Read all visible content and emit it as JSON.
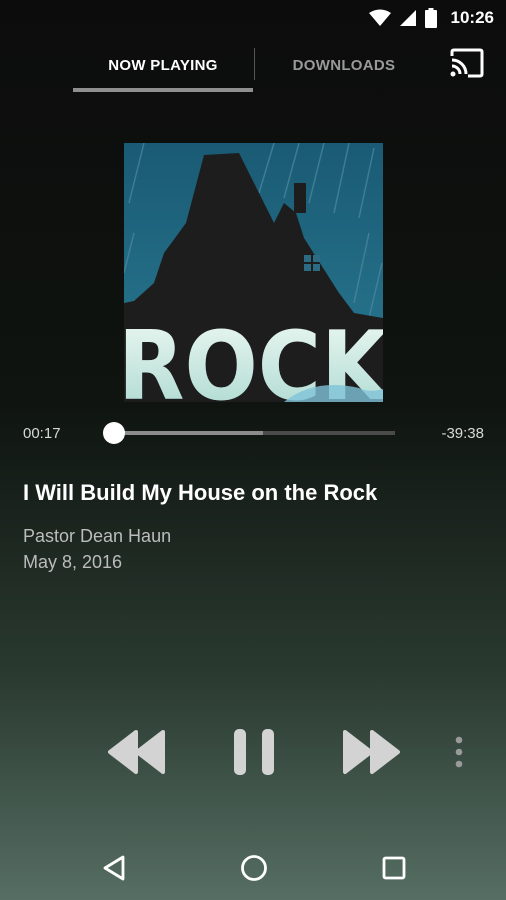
{
  "status_bar": {
    "time": "10:26",
    "icons": [
      "wifi-icon",
      "cell-signal-icon",
      "battery-icon"
    ]
  },
  "tabs": [
    {
      "label": "NOW PLAYING",
      "selected": true
    },
    {
      "label": "DOWNLOADS",
      "selected": false
    }
  ],
  "album_art": {
    "text": "ROCK"
  },
  "player": {
    "elapsed": "00:17",
    "remaining": "-39:38",
    "progress": 0.0,
    "buffered": 0.53
  },
  "track": {
    "title": "I Will Build My House on the Rock",
    "speaker": "Pastor Dean Haun",
    "date": "May 8, 2016"
  },
  "controls": [
    "rewind-icon",
    "pause-icon",
    "fast-forward-icon",
    "more-vert-icon"
  ],
  "nav": [
    "back-icon",
    "home-icon",
    "recents-icon"
  ],
  "colors": {
    "accent": "#ffffff",
    "inactive": "#9a9a9a",
    "art_sky": "#1e5f78",
    "art_text": "#d9eee6"
  }
}
